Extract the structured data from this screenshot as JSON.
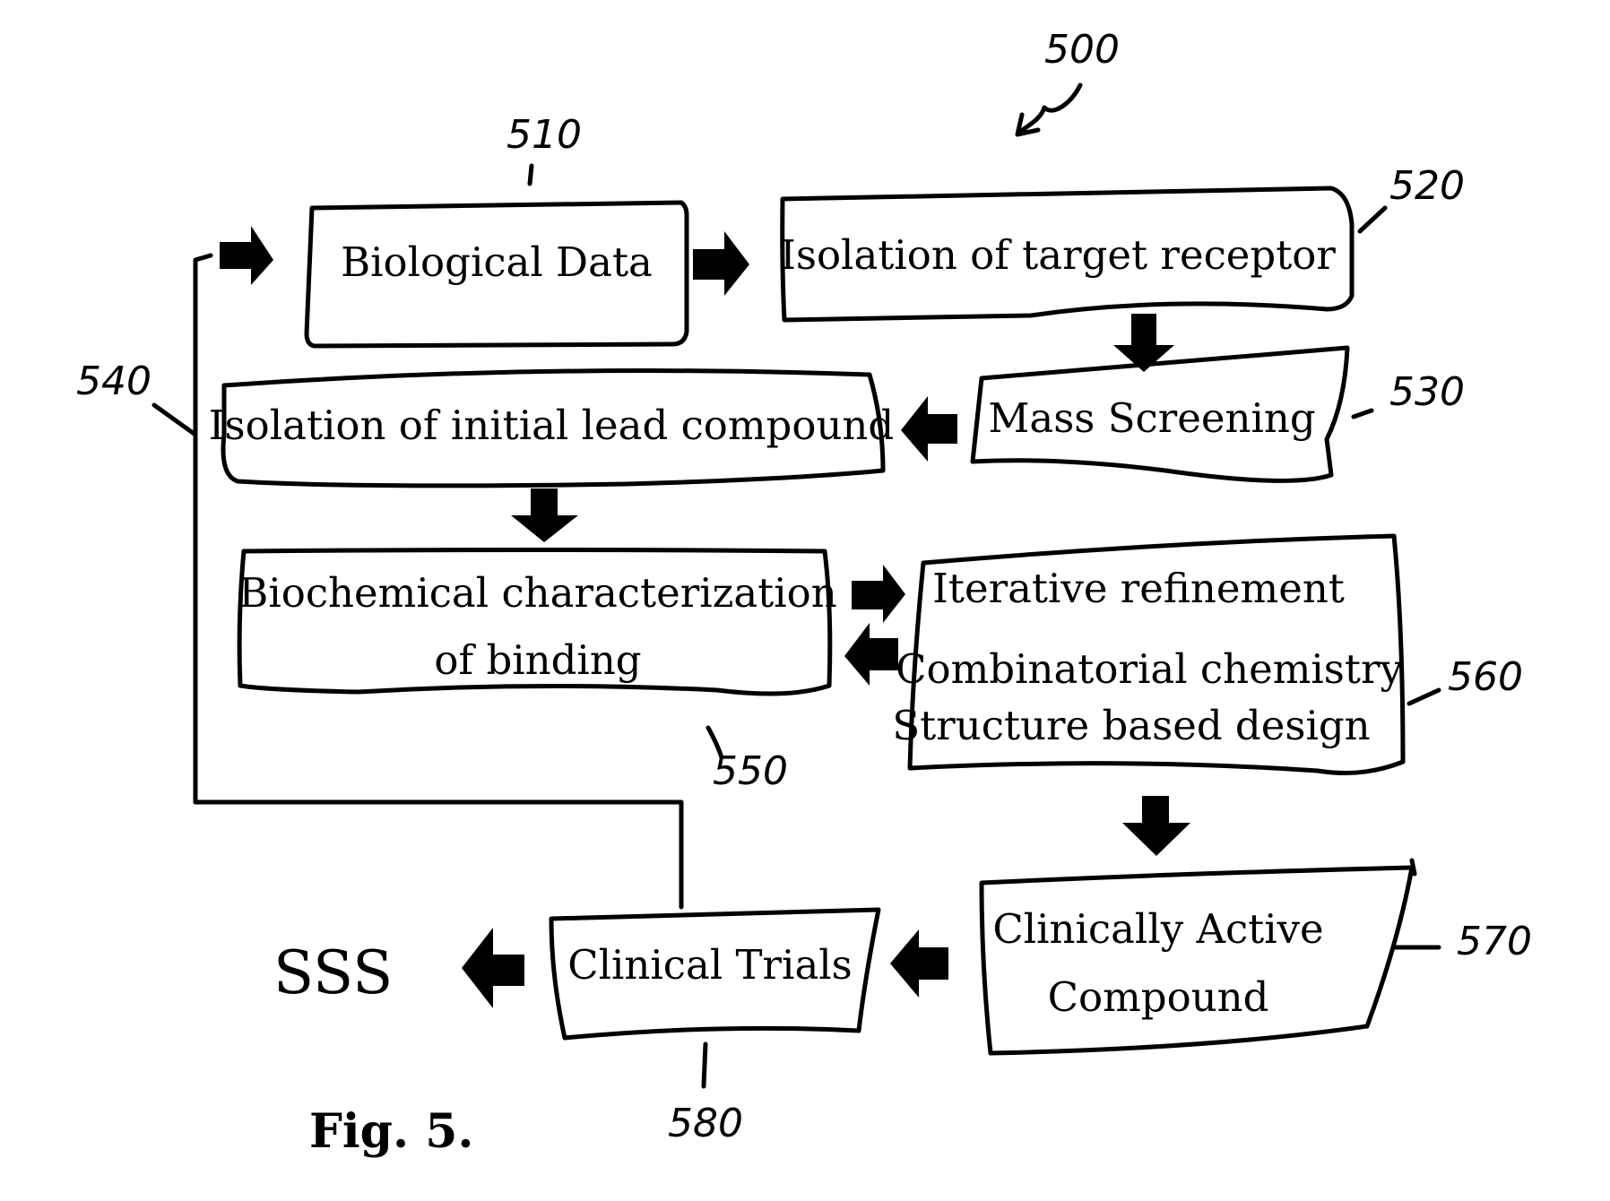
{
  "figure": {
    "caption": "Fig. 5.",
    "reference": "500",
    "outcome_text": "SSS"
  },
  "boxes": {
    "biological_data": {
      "ref": "510",
      "lines": [
        "Biological Data"
      ]
    },
    "isolation_target": {
      "ref": "520",
      "lines": [
        "Isolation of target receptor"
      ]
    },
    "mass_screening": {
      "ref": "530",
      "lines": [
        "Mass Screening"
      ]
    },
    "isolation_lead": {
      "ref": "540",
      "lines": [
        "Isolation of initial lead compound"
      ]
    },
    "biochemical": {
      "ref": "550",
      "lines": [
        "Biochemical characterization",
        "of binding"
      ]
    },
    "refinement": {
      "ref": "560",
      "lines": [
        "Iterative refinement",
        "Combinatorial chemistry",
        "Structure based design"
      ]
    },
    "clinically_active": {
      "ref": "570",
      "lines": [
        "Clinically Active",
        "Compound"
      ]
    },
    "clinical_trials": {
      "ref": "580",
      "lines": [
        "Clinical Trials"
      ]
    }
  }
}
